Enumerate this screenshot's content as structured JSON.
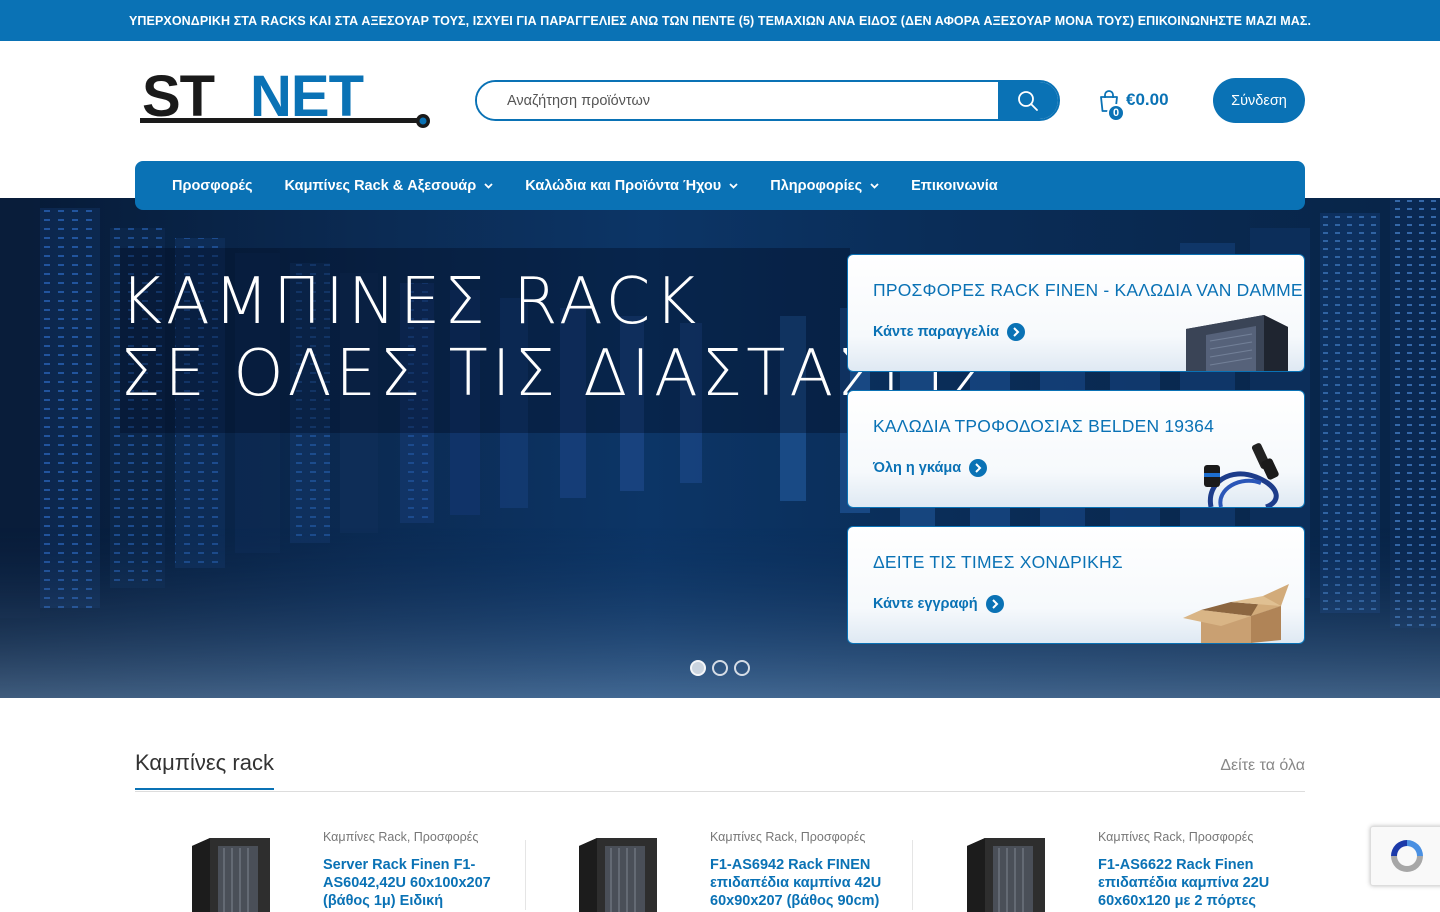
{
  "announcement": "ΥΠΕΡΧΟΝΔΡΙΚΗ ΣΤΑ RACKS ΚΑΙ ΣΤΑ ΑΞΕΣΟΥΑΡ ΤΟΥΣ, ΙΣΧΥΕΙ ΓΙΑ ΠΑΡΑΓΓΕΛΙΕΣ ΑΝΩ ΤΩΝ ΠΕΝΤΕ (5) ΤΕΜΑΧΙΩΝ ΑΝΑ ΕΙΔΟΣ (ΔΕΝ ΑΦΟΡΑ ΑΞΕΣΟΥΑΡ ΜΟΝΑ ΤΟΥΣ) ΕΠΙΚΟΙΝΩΝΗΣΤΕ ΜΑΖΙ ΜΑΣ.",
  "logo": {
    "text_st": "ST",
    "text_net": "NET",
    "colors": {
      "dark": "#1a1a1a",
      "blue": "#0a72b5"
    }
  },
  "search": {
    "placeholder": "Αναζήτηση προϊόντων",
    "icon": "search-icon"
  },
  "cart": {
    "count": "0",
    "amount": "€0.00",
    "icon": "shopping-bag-icon"
  },
  "login_label": "Σύνδεση",
  "nav": {
    "items": [
      {
        "label": "Προσφορές",
        "has_dropdown": false
      },
      {
        "label": "Καμπίνες Rack & Αξεσουάρ",
        "has_dropdown": true
      },
      {
        "label": "Καλώδια και Προϊόντα Ήχου",
        "has_dropdown": true
      },
      {
        "label": "Πληροφορίες",
        "has_dropdown": true
      },
      {
        "label": "Επικοινωνία",
        "has_dropdown": false
      }
    ]
  },
  "hero": {
    "line1": "ΚΑΜΠΙΝΕΣ RACK",
    "line2": "ΣΕ ΟΛΕΣ ΤΙΣ ΔΙΑΣΤΑΣΕΙΣ",
    "slide_count": 3,
    "active_slide": 1
  },
  "promos": [
    {
      "title": "ΠΡΟΣΦΟΡΕΣ RACK FINEN - ΚΑΛΩΔΙΑ VAN DAMME",
      "link": "Κάντε παραγγελία",
      "image": "rack-cabinet-image"
    },
    {
      "title": "ΚΑΛΩΔΙΑ ΤΡΟΦΟΔΟΣΙΑΣ BELDEN 19364",
      "link": "Όλη η γκάμα",
      "image": "power-cable-image"
    },
    {
      "title": "ΔΕΙΤΕ ΤΙΣ ΤΙΜΕΣ ΧΟΝΔΡΙΚΗΣ",
      "link": "Κάντε εγγραφή",
      "image": "cardboard-box-image"
    }
  ],
  "section": {
    "title": "Καμπίνες rack",
    "see_all": "Δείτε τα όλα"
  },
  "products": [
    {
      "cat1": "Καμπίνες Rack",
      "cat2": "Προσφορές",
      "name": "Server Rack Finen F1-AS6042,42U 60x100x207 (βάθος 1μ) Ειδική"
    },
    {
      "cat1": "Καμπίνες Rack",
      "cat2": "Προσφορές",
      "name": "F1-AS6942 Rack FINEN επιδαπέδια καμπίνα 42U 60x90x207 (βάθος 90cm)"
    },
    {
      "cat1": "Καμπίνες Rack",
      "cat2": "Προσφορές",
      "name": "F1-AS6622 Rack Finen επιδαπέδια καμπίνα 22U 60x60x120 με 2 πόρτες"
    }
  ],
  "accent_color": "#0a72b5"
}
